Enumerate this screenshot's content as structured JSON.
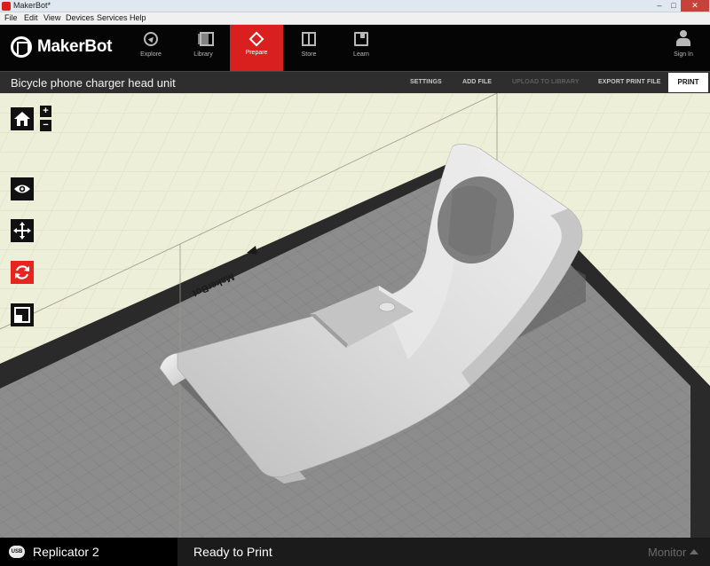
{
  "window": {
    "title": "MakerBot*",
    "controls": {
      "minimize": "–",
      "maximize": "□",
      "close": "✕"
    }
  },
  "menu": [
    "File",
    "Edit",
    "View",
    "Devices",
    "Services",
    "Help"
  ],
  "brand": {
    "name": "MakerBot"
  },
  "nav": [
    {
      "label": "Explore",
      "icon": "compass-icon",
      "active": false
    },
    {
      "label": "Library",
      "icon": "library-icon",
      "active": false
    },
    {
      "label": "Prepare",
      "icon": "prepare-icon",
      "active": true
    },
    {
      "label": "Store",
      "icon": "store-icon",
      "active": false
    },
    {
      "label": "Learn",
      "icon": "book-icon",
      "active": false
    }
  ],
  "account": {
    "label": "Sign In"
  },
  "file": {
    "name": "Bicycle phone charger head unit"
  },
  "actions": {
    "settings": "SETTINGS",
    "add_file": "ADD FILE",
    "upload": "UPLOAD TO LIBRARY",
    "export": "EXPORT PRINT FILE",
    "print": "PRINT"
  },
  "viewport": {
    "plate_brand": "MakerBot",
    "zoom_in": "+",
    "zoom_out": "−"
  },
  "tools": [
    "home-icon",
    "eye-icon",
    "move-icon",
    "rotate-icon",
    "scale-icon"
  ],
  "status": {
    "connection": "USB",
    "printer": "Replicator 2",
    "state": "Ready to Print",
    "monitor": "Monitor"
  },
  "colors": {
    "accent": "#d9201f",
    "toolbar": "#050505",
    "background": "#eeefd8"
  }
}
